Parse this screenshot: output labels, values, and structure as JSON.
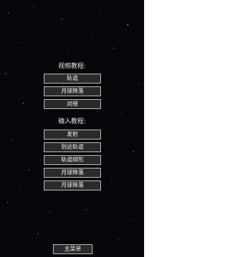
{
  "video_section": {
    "title": "视频教程:",
    "buttons": [
      "轨道",
      "月球降落",
      "对接"
    ]
  },
  "input_section": {
    "title": "输入教程:",
    "buttons": [
      "发射",
      "到达轨道",
      "轨道绑形",
      "月球降落",
      "月球降落"
    ]
  },
  "footer": {
    "main_menu_label": "主菜单"
  },
  "colors": {
    "background": "#05060a",
    "button_fill": "#2a2a2d",
    "button_border": "#bdbdbd",
    "text": "#f2f2f2"
  }
}
